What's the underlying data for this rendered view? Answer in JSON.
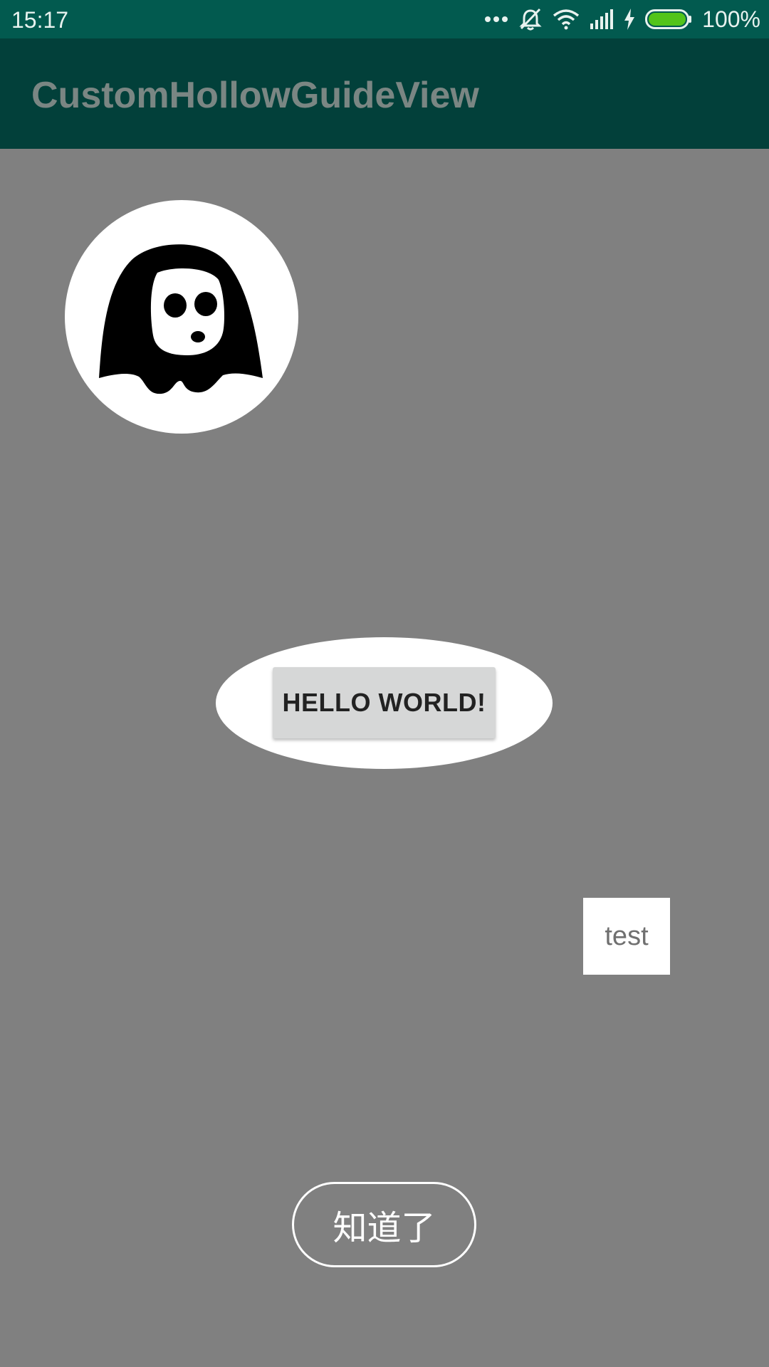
{
  "status_bar": {
    "time": "15:17",
    "battery_percent": "100%",
    "icons": [
      "more-dots-icon",
      "alarm-off-icon",
      "wifi-icon",
      "signal-icon",
      "charging-icon",
      "battery-icon"
    ],
    "battery_color": "#52c41a"
  },
  "app_bar": {
    "title": "CustomHollowGuideView"
  },
  "guide": {
    "avatar_icon": "ghost-mask-icon",
    "hello_button_label": "HELLO WORLD!",
    "test_label": "test",
    "got_it_label": "知道了"
  },
  "colors": {
    "overlay": "#808080",
    "status_bar": "#025a4f",
    "app_bar": "#02403a",
    "highlight": "#ffffff"
  }
}
